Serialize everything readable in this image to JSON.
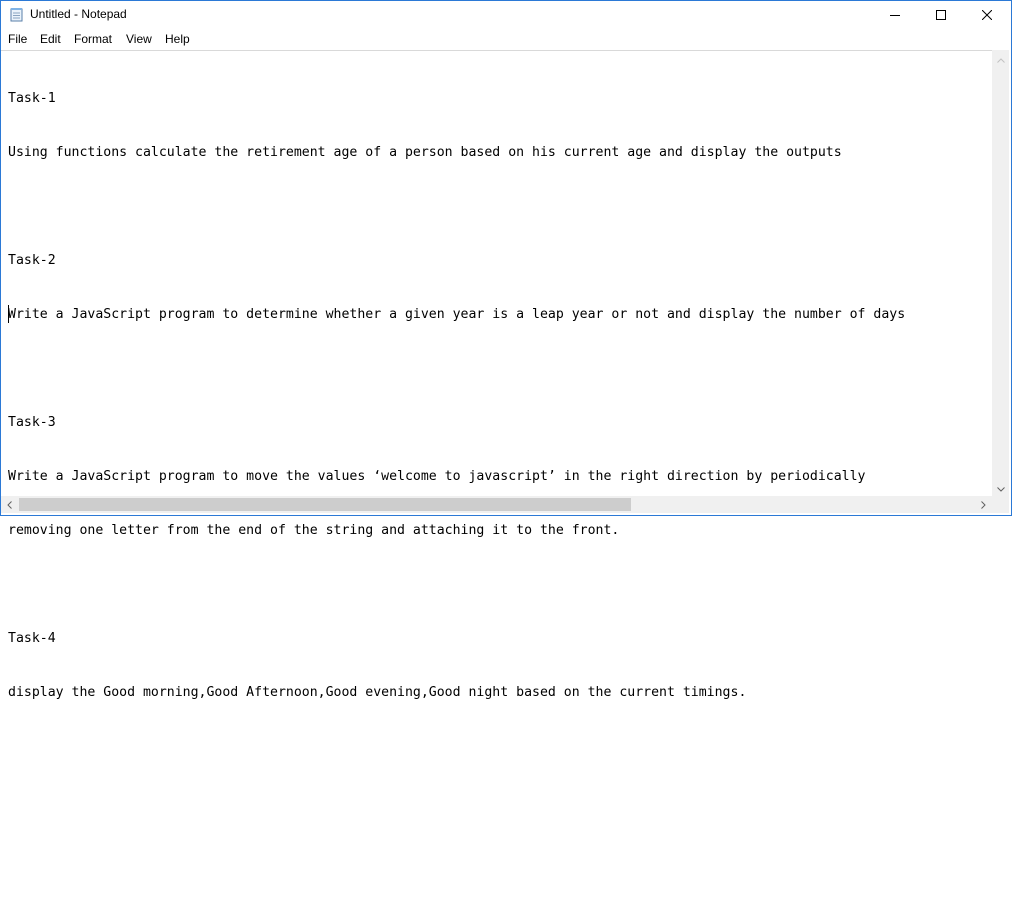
{
  "window": {
    "title": "Untitled - Notepad",
    "icons": {
      "app": "notepad-icon",
      "minimize": "minimize-icon",
      "maximize": "maximize-icon",
      "close": "close-icon"
    },
    "accent_color": "#2b79d6"
  },
  "menu": {
    "file": "File",
    "edit": "Edit",
    "format": "Format",
    "view": "View",
    "help": "Help"
  },
  "document": {
    "lines": [
      "Task-1",
      "Using functions calculate the retirement age of a person based on his current age and display the outputs",
      "",
      "Task-2",
      "Write a JavaScript program to determine whether a given year is a leap year or not and display the number of days",
      "",
      "Task-3",
      "Write a JavaScript program to move the values ‘welcome to javascript’ in the right direction by periodically",
      "removing one letter from the end of the string and attaching it to the front.",
      "",
      "Task-4",
      "display the Good morning,Good Afternoon,Good evening,Good night based on the current timings.",
      "",
      "",
      ""
    ]
  },
  "scrollbars": {
    "vertical": {
      "up": "chevron-up-icon",
      "down": "chevron-down-icon"
    },
    "horizontal": {
      "left": "chevron-left-icon",
      "right": "chevron-right-icon"
    }
  }
}
